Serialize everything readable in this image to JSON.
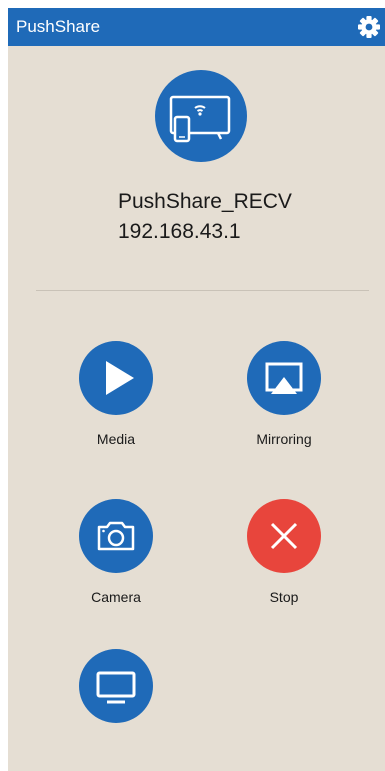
{
  "app": {
    "title": "PushShare",
    "colors": {
      "primary": "#1f6ab8",
      "stop": "#e8453c",
      "background": "#e5ded3"
    }
  },
  "device": {
    "name": "PushShare_RECV",
    "ip": "192.168.43.1",
    "icon": "cast-to-tv-icon"
  },
  "actions": [
    {
      "id": "media",
      "label": "Media",
      "icon": "play-icon"
    },
    {
      "id": "mirroring",
      "label": "Mirroring",
      "icon": "airplay-icon"
    },
    {
      "id": "camera",
      "label": "Camera",
      "icon": "camera-icon"
    },
    {
      "id": "stop",
      "label": "Stop",
      "icon": "close-icon"
    },
    {
      "id": "display",
      "label": "",
      "icon": "monitor-icon"
    }
  ]
}
